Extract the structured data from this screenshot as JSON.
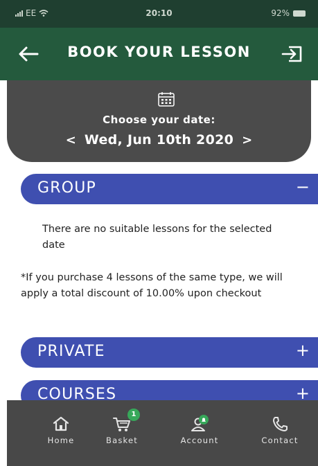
{
  "status_bar": {
    "carrier": "EE",
    "time": "20:10",
    "battery": "92%"
  },
  "header": {
    "title": "BOOK YOUR LESSON",
    "back_icon": "arrow-left-icon",
    "logout_icon": "logout-icon"
  },
  "date_picker": {
    "caption": "Choose your date:",
    "date": "Wed, Jun 10th 2020",
    "prev": "<",
    "next": ">",
    "icon": "calendar-icon"
  },
  "sections": {
    "group": {
      "label": "GROUP",
      "toggle": "−"
    },
    "private": {
      "label": "PRIVATE",
      "toggle": "+"
    },
    "courses": {
      "label": "COURSES",
      "toggle": "+"
    }
  },
  "group_content": {
    "message": "There are no suitable lessons for the selected date"
  },
  "discount_note": "*If you purchase 4 lessons of the same type, we will apply a total discount of 10.00% upon checkout",
  "bottom_nav": {
    "home": {
      "label": "Home",
      "icon": "home-icon"
    },
    "basket": {
      "label": "Basket",
      "icon": "cart-icon",
      "badge": "1"
    },
    "account": {
      "label": "Account",
      "icon": "account-icon"
    },
    "contact": {
      "label": "Contact",
      "icon": "phone-icon"
    }
  },
  "colors": {
    "status_bar": "#1f3f30",
    "header": "#245a3d",
    "date_panel": "#4b4b4b",
    "section_bar": "#3f4fb0",
    "bottom_nav": "#484848",
    "badge": "#37a85a"
  }
}
